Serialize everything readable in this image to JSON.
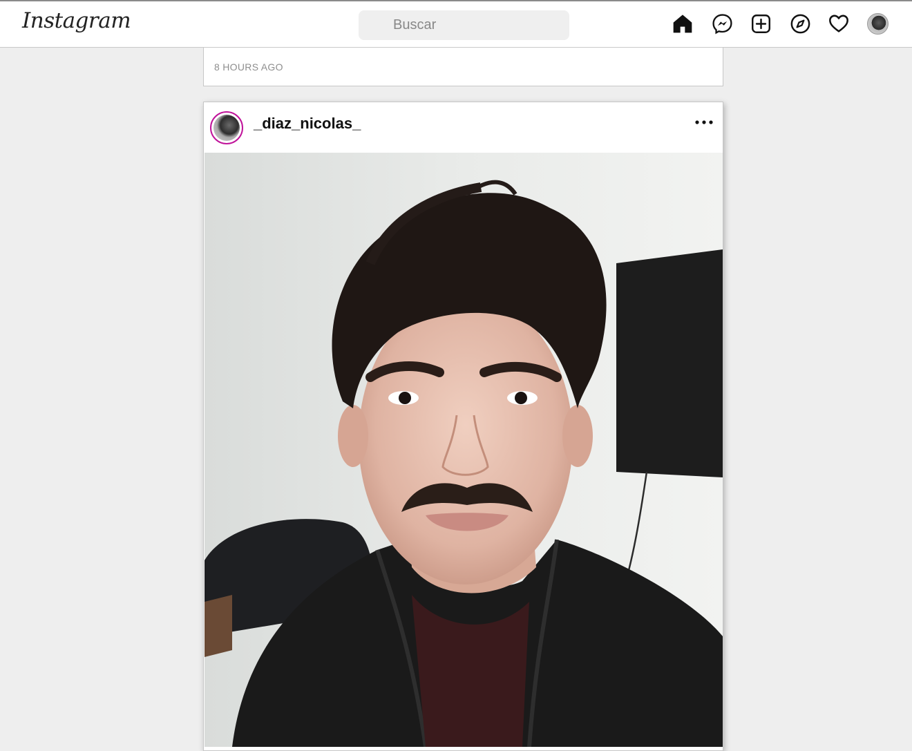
{
  "header": {
    "logo_text": "Instagram",
    "search_placeholder": "Buscar",
    "icons": [
      "home-icon",
      "messenger-icon",
      "new-post-icon",
      "explore-icon",
      "activity-heart-icon",
      "profile-avatar"
    ]
  },
  "feed": {
    "previous_post": {
      "timestamp": "8 HOURS AGO"
    },
    "post": {
      "username": "_diaz_nicolas_",
      "avatar_ring_color": "#c0139a",
      "image_description_icon": "selfie-photo"
    }
  }
}
